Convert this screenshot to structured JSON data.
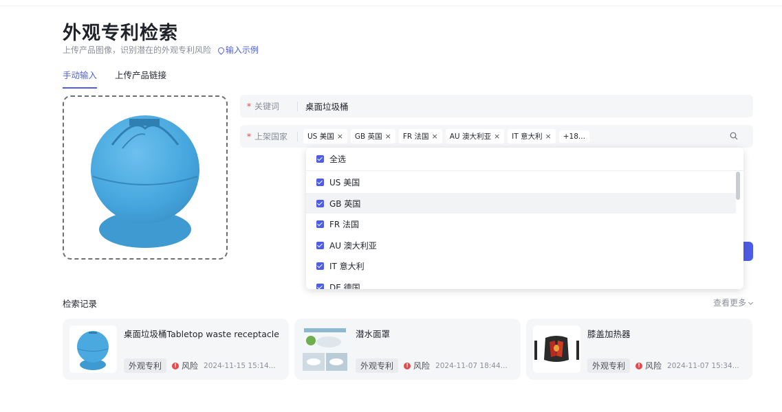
{
  "header": {
    "title": "外观专利检索",
    "subtitle": "上传产品图像，识别潜在的外观专利风险",
    "example_link": "输入示例"
  },
  "tabs": [
    {
      "label": "手动输入",
      "active": true
    },
    {
      "label": "上传产品链接",
      "active": false
    }
  ],
  "form": {
    "keyword": {
      "label": "关键词",
      "value": "桌面垃圾桶"
    },
    "countries": {
      "label": "上架国家",
      "chips": [
        "US 美国",
        "GB 英国",
        "FR 法国",
        "AU 澳大利亚",
        "IT 意大利"
      ],
      "more": "+18..."
    }
  },
  "dropdown": {
    "select_all": "全选",
    "options": [
      "US 美国",
      "GB 英国",
      "FR 法国",
      "AU 澳大利亚",
      "IT 意大利",
      "DE 德国"
    ],
    "hovered": "GB 英国"
  },
  "records": {
    "title": "检索记录",
    "view_more": "查看更多",
    "items": [
      {
        "title": "桌面垃圾桶Tabletop waste receptacle",
        "type": "外观专利",
        "risk": "风险",
        "time": "2024-11-15 15:14..."
      },
      {
        "title": "潜水面罩",
        "type": "外观专利",
        "risk": "风险",
        "time": "2024-11-07 18:44..."
      },
      {
        "title": "膝盖加热器",
        "type": "外观专利",
        "risk": "风险",
        "time": "2024-11-07 15:34..."
      }
    ]
  },
  "colors": {
    "accent": "#4e5de6",
    "risk": "#e5484d",
    "product": "#4aa9de"
  },
  "icons": {
    "example": "pin-icon",
    "search": "search-icon",
    "risk": "alert-icon"
  }
}
